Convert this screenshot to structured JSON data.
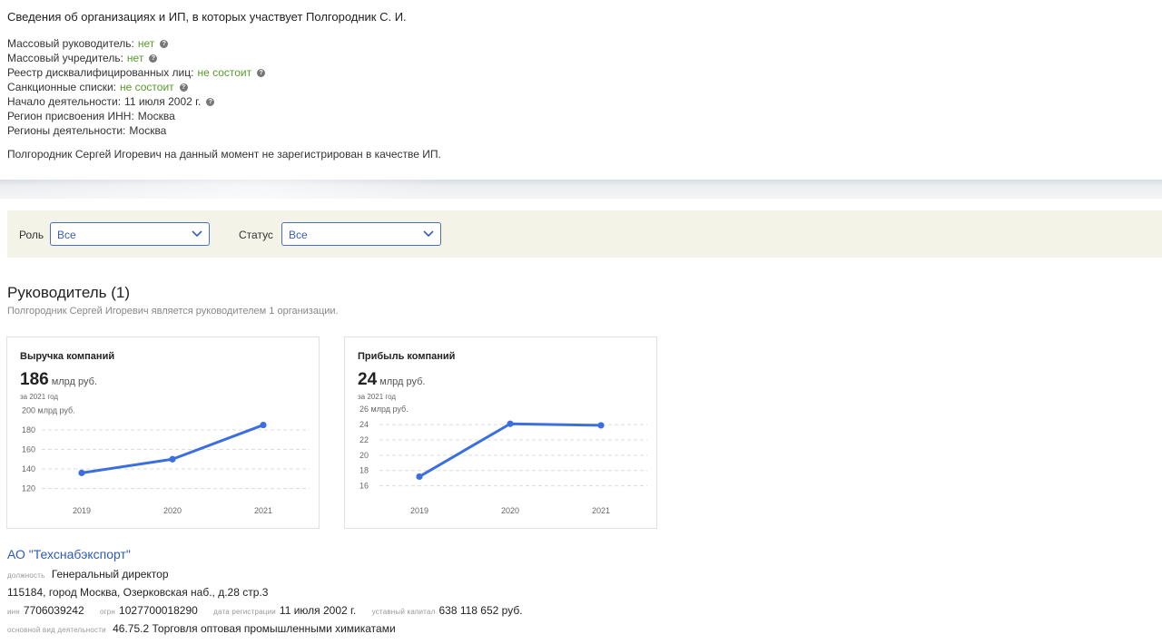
{
  "header": {
    "title": "Сведения об организациях и ИП, в которых участвует Полгородник С. И.",
    "facts": [
      {
        "label": "Массовый руководитель:",
        "value": "нет",
        "green": true,
        "help": true
      },
      {
        "label": "Массовый учредитель:",
        "value": "нет",
        "green": true,
        "help": true
      },
      {
        "label": "Реестр дисквалифицированных лиц:",
        "value": "не состоит",
        "green": true,
        "help": true
      },
      {
        "label": "Санкционные списки:",
        "value": "не состоит",
        "green": true,
        "help": true
      },
      {
        "label": "Начало деятельности:",
        "value": "11 июля 2002 г.",
        "green": false,
        "help": true
      },
      {
        "label": "Регион присвоения ИНН:",
        "value": "Москва",
        "green": false,
        "help": false
      },
      {
        "label": "Регионы деятельности:",
        "value": "Москва",
        "green": false,
        "help": false
      }
    ],
    "note": "Полгородник Сергей Игоревич на данный момент не зарегистрирован в качестве ИП."
  },
  "filters": {
    "role_label": "Роль",
    "role_value": "Все",
    "status_label": "Статус",
    "status_value": "Все"
  },
  "section": {
    "title": "Руководитель (1)",
    "subtitle": "Полгородник Сергей Игоревич является руководителем 1 организации."
  },
  "cards": [
    {
      "title": "Выручка компаний",
      "big": "186",
      "unit": "млрд руб.",
      "year": "за 2021 год"
    },
    {
      "title": "Прибыль компаний",
      "big": "24",
      "unit": "млрд руб.",
      "year": "за 2021 год"
    }
  ],
  "chart_data": [
    {
      "type": "line",
      "title": "Выручка компаний",
      "x": [
        "2019",
        "2020",
        "2021"
      ],
      "values": [
        136,
        150,
        185
      ],
      "ylim": [
        115,
        205
      ],
      "yticks": [
        120,
        140,
        160,
        180,
        200
      ],
      "ytick_labels": [
        "120",
        "140",
        "160",
        "180",
        "200 млрд руб."
      ],
      "grid": true,
      "color": "#3b6fe0"
    },
    {
      "type": "line",
      "title": "Прибыль компаний",
      "x": [
        "2019",
        "2020",
        "2021"
      ],
      "values": [
        17.2,
        24.1,
        23.9
      ],
      "ylim": [
        15,
        26.5
      ],
      "yticks": [
        16,
        18,
        20,
        22,
        24,
        26
      ],
      "ytick_labels": [
        "16",
        "18",
        "20",
        "22",
        "24",
        "26 млрд руб."
      ],
      "grid": true,
      "color": "#3b6fe0"
    }
  ],
  "org": {
    "name": "АО \"Техснабэкспорт\"",
    "position_label": "должность",
    "position": "Генеральный директор",
    "address": "115184, город Москва, Озерковская наб., д.28 стр.3",
    "inn_label": "инн",
    "inn": "7706039242",
    "ogrn_label": "огрн",
    "ogrn": "1027700018290",
    "reg_label": "дата регистрации",
    "reg": "11 июля 2002 г.",
    "capital_label": "уставный капитал",
    "capital": "638 118 652 руб.",
    "activity_label": "основной вид деятельности",
    "activity": "46.75.2 Торговля оптовая промышленными химикатами"
  }
}
